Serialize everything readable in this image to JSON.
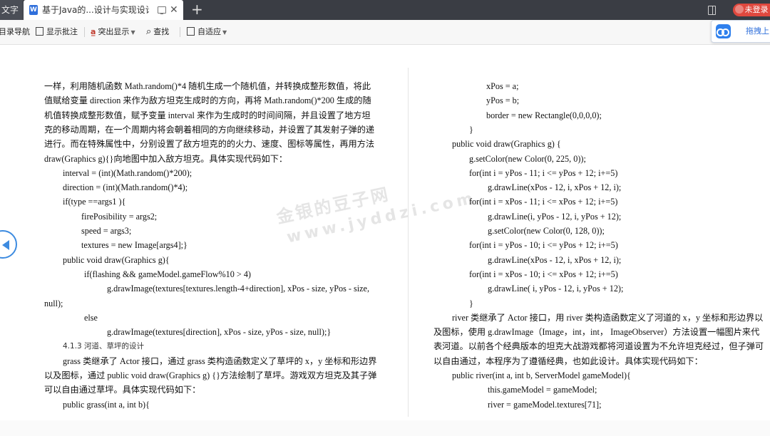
{
  "tabs": {
    "prev_label": "文字",
    "active_icon": "W",
    "active_title": "基于Java的...设计与实现设计"
  },
  "header_right": {
    "login_label": "未登录"
  },
  "toolbar": {
    "toc_label": "目录导航",
    "comments_label": "显示批注",
    "highlight_label": "突出显示",
    "find_label": "查找",
    "fit_label": "自适应"
  },
  "baidu": {
    "label": "拖拽上"
  },
  "watermark": {
    "brand": "金银的豆子网",
    "url": "www.jyddzi.com"
  },
  "left_page": {
    "lines": [
      "一样，利用随机函数 Math.random()*4 随机生成一个随机值，并转换成整形数值，将此",
      "值赋给变量 direction 来作为敌方坦克生成时的方向，再将 Math.random()*200 生成的随",
      "机值转换成整形数值，赋予变量 interval 来作为生成时的时间间隔，并且设置了地方坦",
      "克的移动周期，在一个周期内将会朝着相同的方向继续移动，并设置了其发射子弹的递",
      "进行。而在特殊属性中，分别设置了敌方坦克的的火力、速度、图标等属性，再用方法",
      "draw(Graphics g){}向地图中加入敌方坦克。具体实现代码如下：",
      "interval = (int)(Math.random()*200);",
      "direction = (int)(Math.random()*4);",
      "if(type ==args1 ){",
      "firePosibility = args2;",
      "speed = args3;",
      "textures = new Image[args4];}",
      "public void draw(Graphics g){",
      "if(flashing && gameModel.gameFlow%10 > 4)",
      "g.drawImage(textures[textures.length-4+direction],  xPos  -  size,  yPos  -  size,",
      "null);",
      "else",
      "g.drawImage(textures[direction], xPos - size, yPos - size, null);}",
      "4.1.3 河道、草坪的设计",
      "grass 类继承了 Actor 接口，通过 grass 类构造函数定义了草坪的 x，y 坐标和形边界",
      "以及图标，通过 public void draw(Graphics g) {}方法绘制了草坪。游戏双方坦克及其子弹",
      "可以自由通过草坪。具体实现代码如下：",
      "public grass(int a, int b){"
    ]
  },
  "right_page": {
    "lines": [
      "xPos = a;",
      "yPos = b;",
      "border = new Rectangle(0,0,0,0);",
      "}",
      "public void draw(Graphics g) {",
      "g.setColor(new Color(0, 225, 0));",
      "for(int i = yPos - 11; i <= yPos + 12; i+=5)",
      "g.drawLine(xPos - 12, i, xPos + 12, i);",
      "for(int i = xPos - 11; i <= xPos + 12; i+=5)",
      "g.drawLine(i, yPos - 12, i, yPos + 12);",
      "g.setColor(new Color(0, 128, 0));",
      "for(int i = yPos - 10; i <= yPos + 12; i+=5)",
      "g.drawLine(xPos - 12, i, xPos + 12, i);",
      "for(int i = xPos - 10; i <= xPos + 12; i+=5)",
      "g.drawLine( i, yPos - 12, i, yPos + 12);",
      "}",
      "river 类继承了 Actor 接口，用 river 类构造函数定义了河道的 x，y 坐标和形边界以",
      "及图标，使用 g.drawImage（Image，int，int，  ImageObserver）方法设置一幅图片来代",
      "表河道。以前各个经典版本的坦克大战游戏都将河道设置为不允许坦克经过，但子弹可",
      "以自由通过，本程序为了遵循经典，也如此设计。具体实现代码如下：",
      "public river(int a, int b, ServerModel gameModel){",
      "this.gameModel = gameModel;",
      "river = gameModel.textures[71];"
    ]
  }
}
